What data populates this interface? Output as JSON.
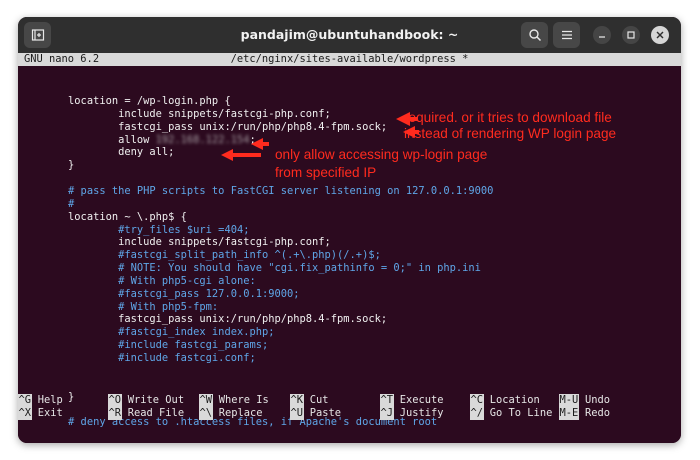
{
  "window": {
    "title": "pandajim@ubuntuhandbook: ~",
    "buttons": {
      "new_tab_icon": "new-tab-icon",
      "search_icon": "search-icon",
      "menu_icon": "hamburger-menu-icon"
    }
  },
  "nano": {
    "version": "GNU nano 6.2",
    "file": "/etc/nginx/sites-available/wordpress *"
  },
  "code_lines": [
    "        location = /wp-login.php {",
    "                include snippets/fastcgi-php.conf;",
    "                fastcgi_pass unix:/run/php/php8.4-fpm.sock;",
    "                allow ",
    "                deny all;",
    "        }",
    "",
    "        # pass the PHP scripts to FastCGI server listening on 127.0.0.1:9000",
    "        #",
    "        location ~ \\.php$ {",
    "                #try_files $uri =404;",
    "                include snippets/fastcgi-php.conf;",
    "                #fastcgi_split_path_info ^(.+\\.php)(/.+)$;",
    "                # NOTE: You should have \"cgi.fix_pathinfo = 0;\" in php.ini",
    "                # With php5-cgi alone:",
    "                #fastcgi_pass 127.0.0.1:9000;",
    "                # With php5-fpm:",
    "                fastcgi_pass unix:/run/php/php8.4-fpm.sock;",
    "                #fastcgi_index index.php;",
    "                #include fastcgi_params;",
    "                #include fastcgi.conf;",
    "",
    "",
    "        }",
    "",
    "        # deny access to .htaccess files, if Apache's document root"
  ],
  "redacted_ip": "192.168.122.154",
  "annotations": {
    "note1_line1": "required. or it tries to download file",
    "note1_line2": "instead of rendering WP login page",
    "note2_line1": "only allow accessing wp-login page",
    "note2_line2": "from specified IP"
  },
  "shortcuts": [
    {
      "key": "^G",
      "label": "Help"
    },
    {
      "key": "^X",
      "label": "Exit"
    },
    {
      "key": "^O",
      "label": "Write Out"
    },
    {
      "key": "^R",
      "label": "Read File"
    },
    {
      "key": "^W",
      "label": "Where Is"
    },
    {
      "key": "^\\",
      "label": "Replace"
    },
    {
      "key": "^K",
      "label": "Cut"
    },
    {
      "key": "^U",
      "label": "Paste"
    },
    {
      "key": "^T",
      "label": "Execute"
    },
    {
      "key": "^J",
      "label": "Justify"
    },
    {
      "key": "^C",
      "label": "Location"
    },
    {
      "key": "^/",
      "label": "Go To Line"
    },
    {
      "key": "M-U",
      "label": "Undo"
    },
    {
      "key": "M-E",
      "label": "Redo"
    }
  ],
  "colors": {
    "terminal_bg": "#2c0a1f",
    "comment": "#5fa6e8",
    "annotation": "#ff2b1e",
    "header_bg": "#d9d9d9"
  }
}
